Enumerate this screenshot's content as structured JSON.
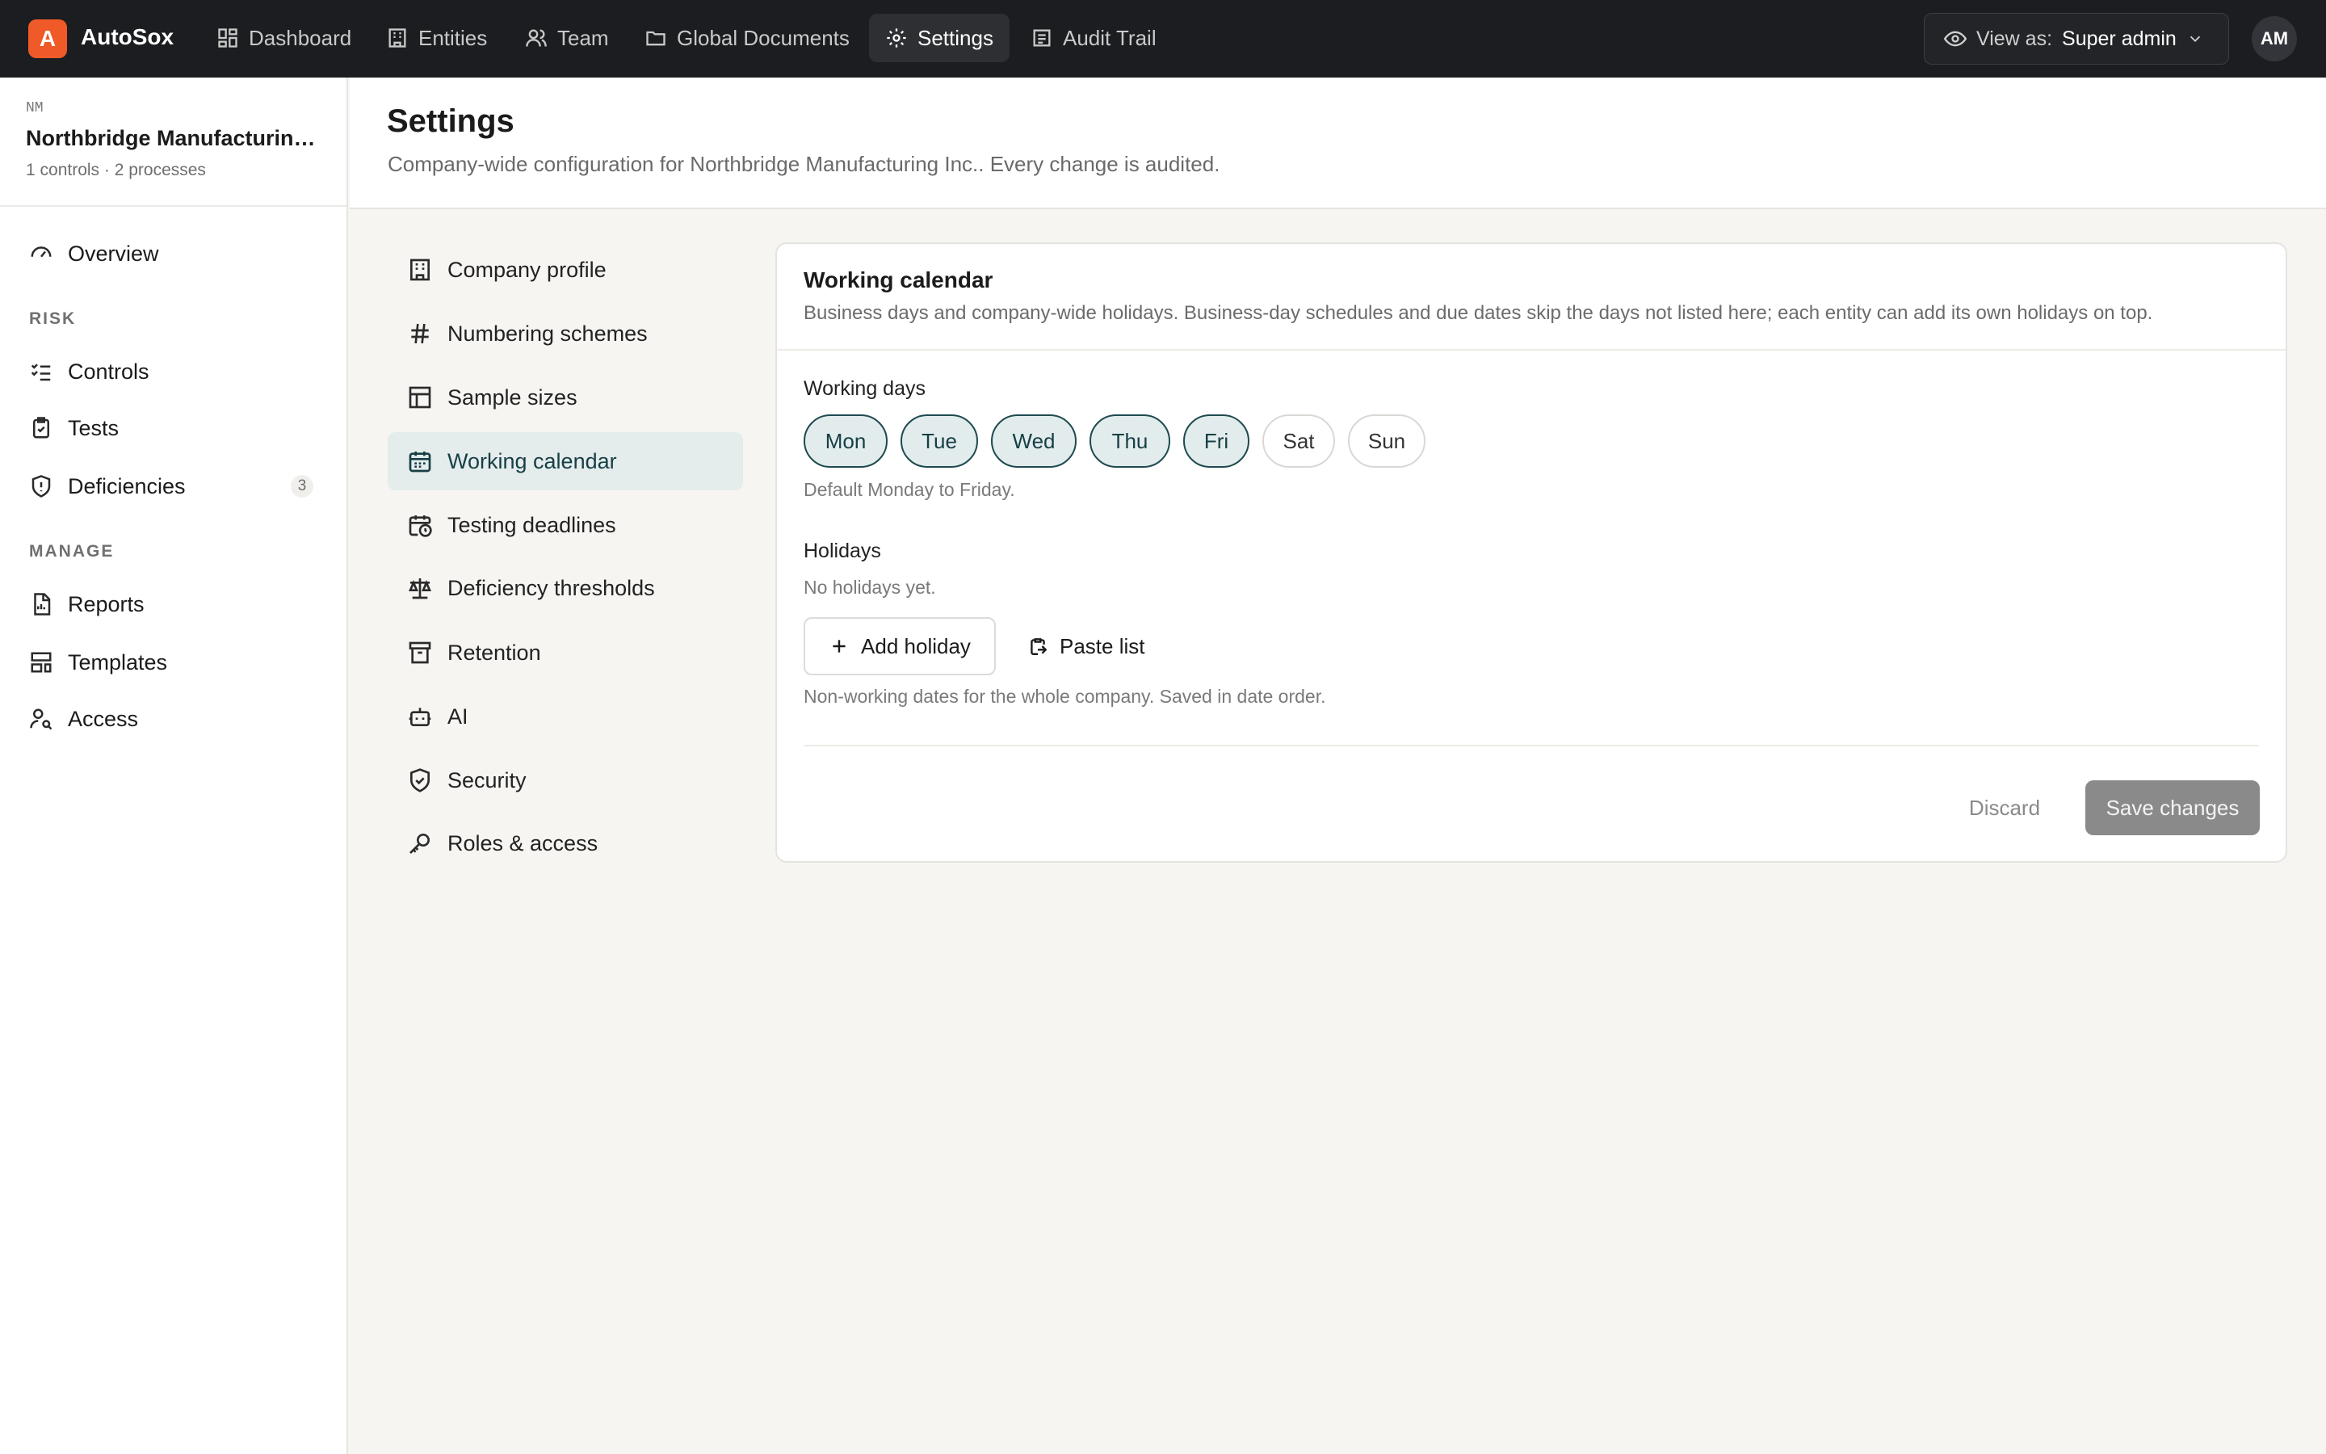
{
  "app": {
    "logo_letter": "A",
    "name": "AutoSox",
    "brand_color": "#f05a28"
  },
  "topnav": [
    {
      "label": "Dashboard",
      "icon": "dashboard-icon"
    },
    {
      "label": "Entities",
      "icon": "building-icon"
    },
    {
      "label": "Team",
      "icon": "users-icon"
    },
    {
      "label": "Global Documents",
      "icon": "folder-icon"
    },
    {
      "label": "Settings",
      "icon": "gear-icon",
      "active": true
    },
    {
      "label": "Audit Trail",
      "icon": "audit-trail-icon"
    }
  ],
  "view_as": {
    "label": "View as:",
    "value": "Super admin"
  },
  "user": {
    "initials": "AM"
  },
  "entity": {
    "initials": "NM",
    "name": "Northbridge Manufacturing Inc.",
    "meta": "1 controls · 2 processes"
  },
  "sidebar": {
    "overview": "Overview",
    "risk_heading": "RISK",
    "controls": "Controls",
    "tests": "Tests",
    "deficiencies": "Deficiencies",
    "deficiencies_count": "3",
    "manage_heading": "MANAGE",
    "reports": "Reports",
    "templates": "Templates",
    "access": "Access"
  },
  "page": {
    "title": "Settings",
    "subtitle": "Company-wide configuration for Northbridge Manufacturing Inc.. Every change is audited."
  },
  "settings_nav": [
    {
      "label": "Company profile",
      "icon": "building-icon"
    },
    {
      "label": "Numbering schemes",
      "icon": "hash-icon"
    },
    {
      "label": "Sample sizes",
      "icon": "table-icon"
    },
    {
      "label": "Working calendar",
      "icon": "calendar-icon",
      "active": true
    },
    {
      "label": "Testing deadlines",
      "icon": "calendar-clock-icon"
    },
    {
      "label": "Deficiency thresholds",
      "icon": "scale-icon"
    },
    {
      "label": "Retention",
      "icon": "archive-icon"
    },
    {
      "label": "AI",
      "icon": "bot-icon"
    },
    {
      "label": "Security",
      "icon": "shield-check-icon"
    },
    {
      "label": "Roles & access",
      "icon": "key-icon"
    }
  ],
  "card": {
    "title": "Working calendar",
    "description": "Business days and company-wide holidays. Business-day schedules and due dates skip the days not listed here; each entity can add its own holidays on top.",
    "working_days_label": "Working days",
    "days": [
      {
        "label": "Mon",
        "selected": true
      },
      {
        "label": "Tue",
        "selected": true
      },
      {
        "label": "Wed",
        "selected": true
      },
      {
        "label": "Thu",
        "selected": true
      },
      {
        "label": "Fri",
        "selected": true
      },
      {
        "label": "Sat",
        "selected": false
      },
      {
        "label": "Sun",
        "selected": false
      }
    ],
    "working_days_hint": "Default Monday to Friday.",
    "holidays_label": "Holidays",
    "holidays_empty": "No holidays yet.",
    "add_holiday": "Add holiday",
    "paste_list": "Paste list",
    "holidays_hint": "Non-working dates for the whole company. Saved in date order.",
    "discard": "Discard",
    "save": "Save changes"
  }
}
